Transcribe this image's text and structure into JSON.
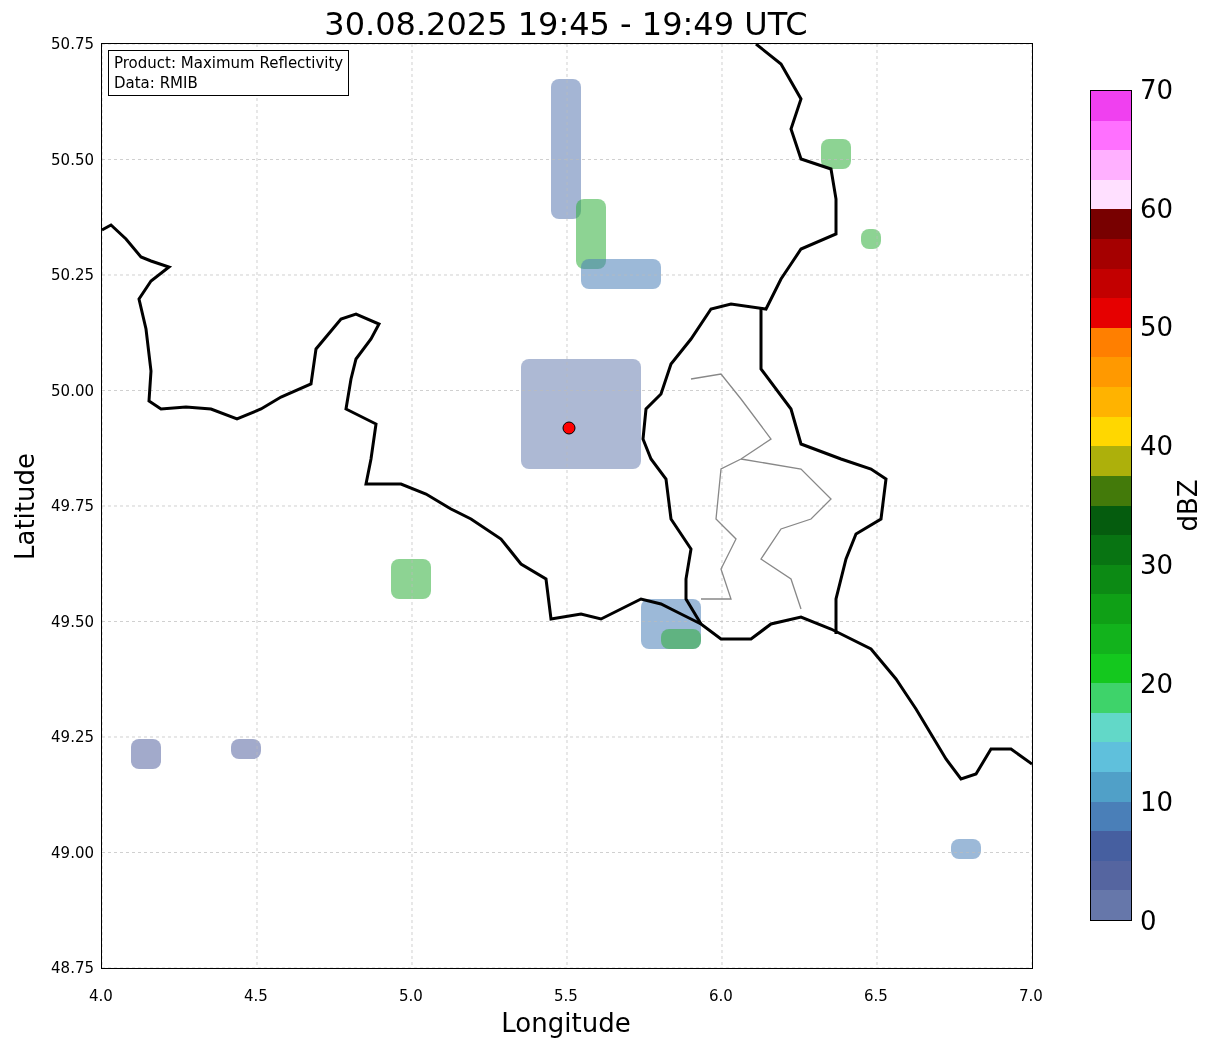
{
  "title": "30.08.2025 19:45 - 19:49 UTC",
  "legend": [
    "Product: Maximum Reflectivity",
    "Data: RMIB"
  ],
  "x_axis": {
    "label": "Longitude",
    "ticks": [
      "4.0",
      "4.5",
      "5.0",
      "5.5",
      "6.0",
      "6.5",
      "7.0"
    ]
  },
  "y_axis": {
    "label": "Latitude",
    "ticks": [
      "50.75",
      "50.50",
      "50.25",
      "50.00",
      "49.75",
      "49.50",
      "49.25",
      "49.00",
      "48.75"
    ]
  },
  "colorbar": {
    "label": "dBZ",
    "ticks": [
      "70",
      "60",
      "50",
      "40",
      "30",
      "20",
      "10",
      "0"
    ],
    "segments": [
      {
        "color": "#f040f0"
      },
      {
        "color": "#ff70ff"
      },
      {
        "color": "#ffb0ff"
      },
      {
        "color": "#ffe0ff"
      },
      {
        "color": "#780000"
      },
      {
        "color": "#a50000"
      },
      {
        "color": "#c30000"
      },
      {
        "color": "#e60000"
      },
      {
        "color": "#ff7f00"
      },
      {
        "color": "#ff9900"
      },
      {
        "color": "#ffb300"
      },
      {
        "color": "#ffd700"
      },
      {
        "color": "#adb00b"
      },
      {
        "color": "#437a0a"
      },
      {
        "color": "#055c0e"
      },
      {
        "color": "#087412"
      },
      {
        "color": "#0c8a14"
      },
      {
        "color": "#0fa016"
      },
      {
        "color": "#12b31c"
      },
      {
        "color": "#14c81e"
      },
      {
        "color": "#3ed36a"
      },
      {
        "color": "#62d8c8"
      },
      {
        "color": "#5fc0dc"
      },
      {
        "color": "#50a0c8"
      },
      {
        "color": "#4a7fb8"
      },
      {
        "color": "#465fa0"
      },
      {
        "color": "#5565a0"
      },
      {
        "color": "#6677aa"
      }
    ]
  }
}
